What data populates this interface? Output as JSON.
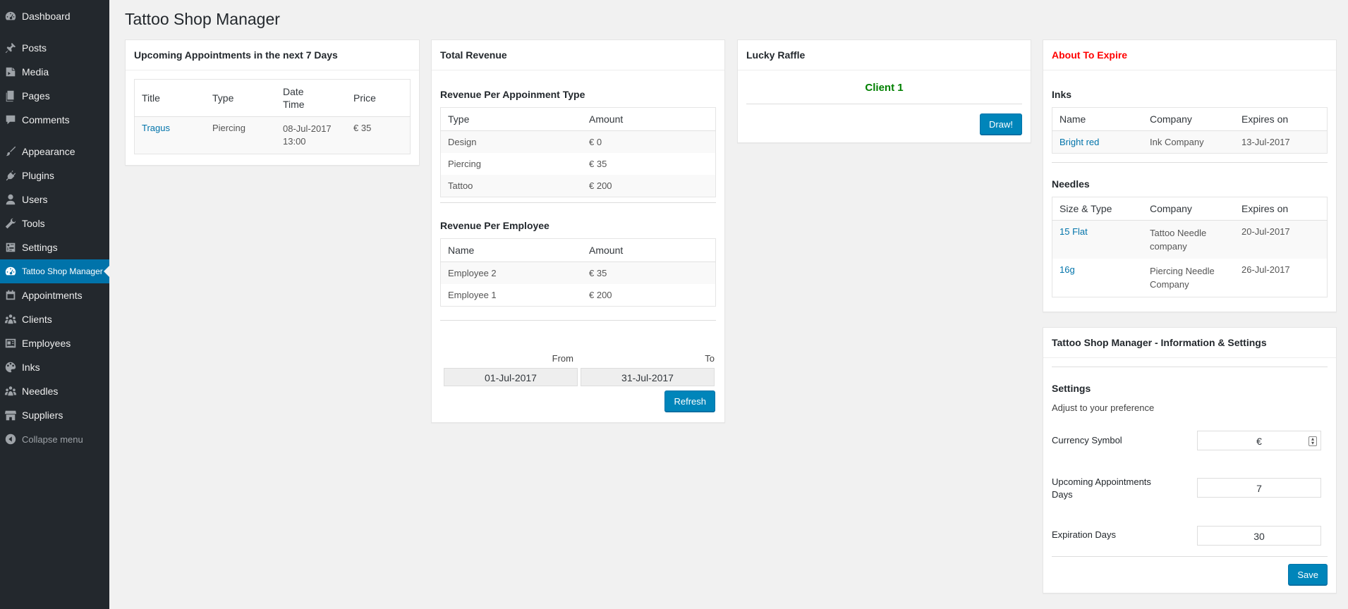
{
  "sidebar": {
    "items": [
      {
        "label": "Dashboard",
        "icon": "dashboard-icon"
      },
      {
        "label": "Posts",
        "icon": "pin-icon"
      },
      {
        "label": "Media",
        "icon": "media-icon"
      },
      {
        "label": "Pages",
        "icon": "pages-icon"
      },
      {
        "label": "Comments",
        "icon": "comment-icon"
      },
      {
        "label": "Appearance",
        "icon": "brush-icon"
      },
      {
        "label": "Plugins",
        "icon": "plugin-icon"
      },
      {
        "label": "Users",
        "icon": "user-icon"
      },
      {
        "label": "Tools",
        "icon": "wrench-icon"
      },
      {
        "label": "Settings",
        "icon": "settings-icon"
      },
      {
        "label": "Tattoo Shop Manager",
        "icon": "dashboard-icon"
      },
      {
        "label": "Appointments",
        "icon": "calendar-icon"
      },
      {
        "label": "Clients",
        "icon": "groups-icon"
      },
      {
        "label": "Employees",
        "icon": "id-card-icon"
      },
      {
        "label": "Inks",
        "icon": "palette-icon"
      },
      {
        "label": "Needles",
        "icon": "groups-icon"
      },
      {
        "label": "Suppliers",
        "icon": "store-icon"
      }
    ],
    "collapse_label": "Collapse menu"
  },
  "page_title": "Tattoo Shop Manager",
  "upcoming": {
    "title": "Upcoming Appointments in the next 7 Days",
    "headers": [
      "Title",
      "Type",
      "Date Time",
      "Price"
    ],
    "rows": [
      {
        "title": "Tragus",
        "type": "Piercing",
        "date": "08-Jul-2017",
        "time": "13:00",
        "price": "€ 35"
      }
    ]
  },
  "revenue": {
    "title": "Total Revenue",
    "per_type_title": "Revenue Per Appoinment Type",
    "per_type_headers": [
      "Type",
      "Amount"
    ],
    "per_type_rows": [
      {
        "type": "Design",
        "amount": "€ 0"
      },
      {
        "type": "Piercing",
        "amount": "€ 35"
      },
      {
        "type": "Tattoo",
        "amount": "€ 200"
      }
    ],
    "per_employee_title": "Revenue Per Employee",
    "per_employee_headers": [
      "Name",
      "Amount"
    ],
    "per_employee_rows": [
      {
        "name": "Employee 2",
        "amount": "€ 35"
      },
      {
        "name": "Employee 1",
        "amount": "€ 200"
      }
    ],
    "from_label": "From",
    "to_label": "To",
    "from_value": "01-Jul-2017",
    "to_value": "31-Jul-2017",
    "refresh_label": "Refresh"
  },
  "raffle": {
    "title": "Lucky Raffle",
    "winner": "Client 1",
    "draw_label": "Draw!"
  },
  "expire": {
    "title": "About To Expire",
    "inks_title": "Inks",
    "inks_headers": [
      "Name",
      "Company",
      "Expires on"
    ],
    "inks_rows": [
      {
        "name": "Bright red",
        "company": "Ink Company",
        "expires": "13-Jul-2017"
      }
    ],
    "needles_title": "Needles",
    "needles_headers": [
      "Size & Type",
      "Company",
      "Expires on"
    ],
    "needles_rows": [
      {
        "name": "15 Flat",
        "company": "Tattoo Needle company",
        "expires": "20-Jul-2017"
      },
      {
        "name": "16g",
        "company": "Piercing Needle Company",
        "expires": "26-Jul-2017"
      }
    ]
  },
  "settings": {
    "title": "Tattoo Shop Manager - Information & Settings",
    "heading": "Settings",
    "subtitle": "Adjust to your preference",
    "currency_label": "Currency Symbol",
    "currency_value": "€",
    "upcoming_label": "Upcoming Appointments Days",
    "upcoming_value": "7",
    "expiration_label": "Expiration Days",
    "expiration_value": "30",
    "save_label": "Save"
  },
  "colors": {
    "sidebar_bg": "#23282d",
    "accent": "#0073aa",
    "raffle_green": "#008000",
    "expire_red": "#ff0000"
  }
}
